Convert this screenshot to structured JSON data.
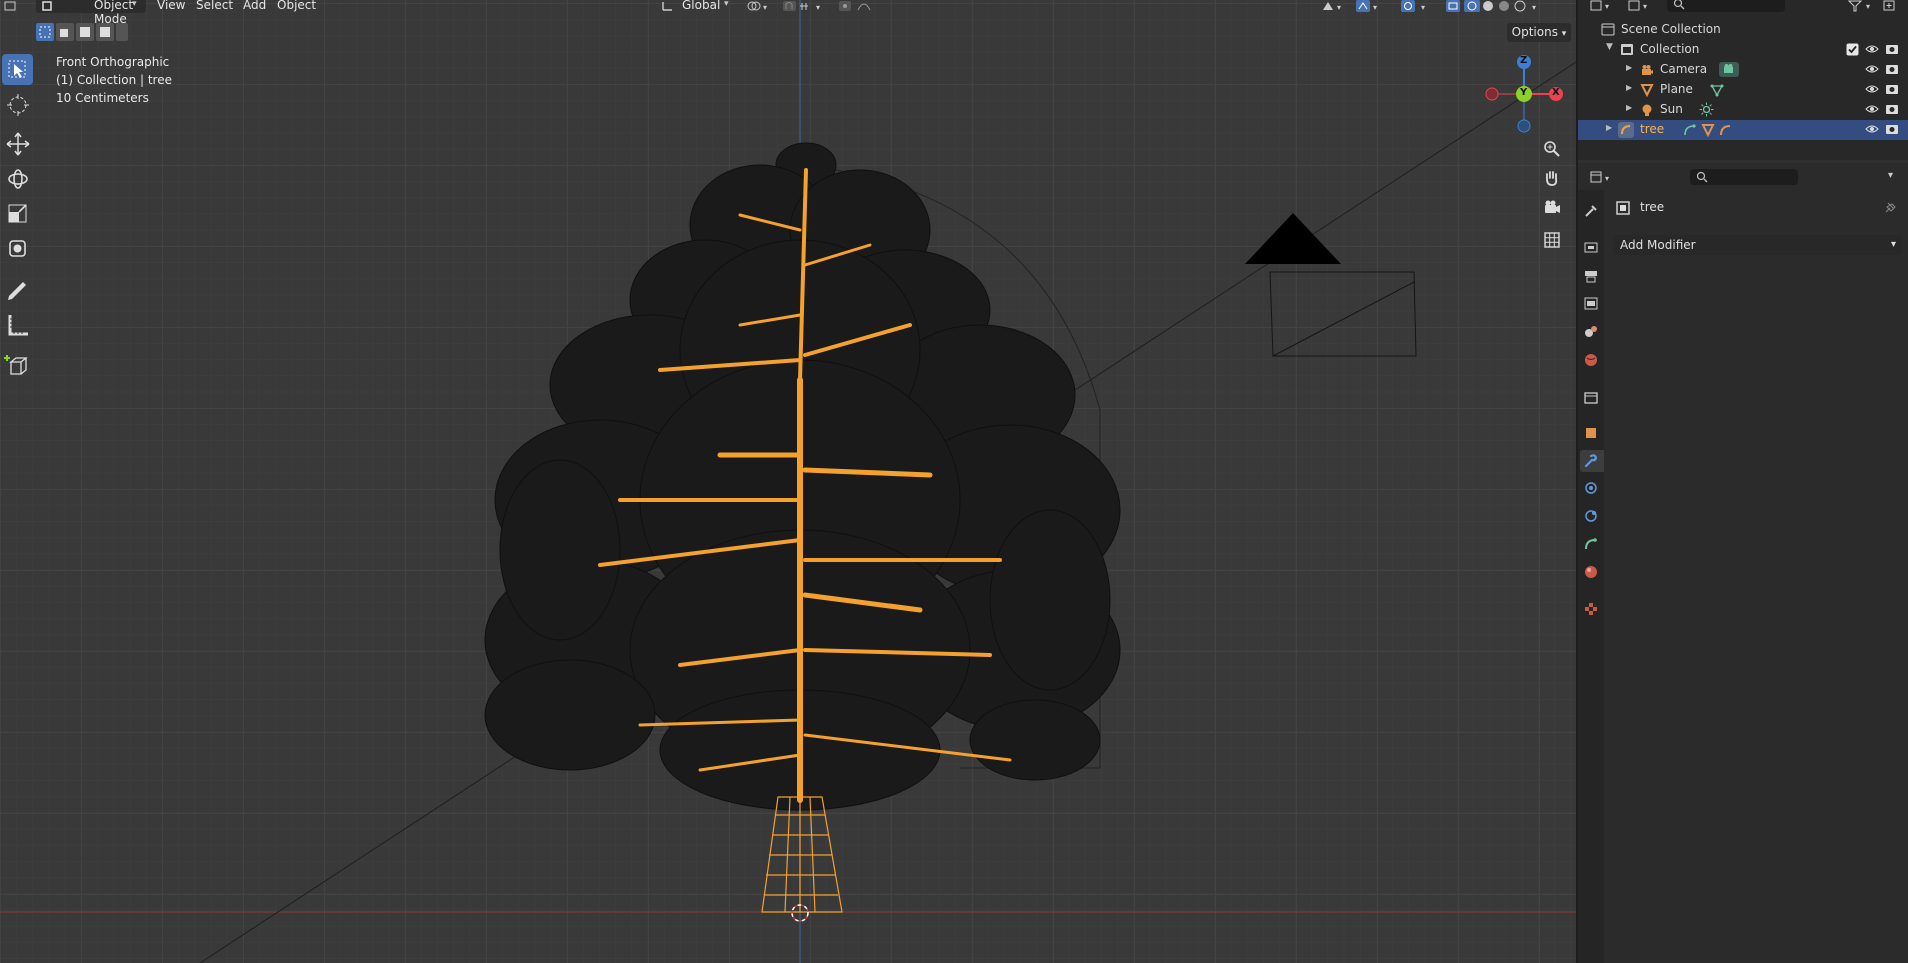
{
  "header": {
    "mode_label": "Object Mode",
    "menus": [
      "View",
      "Select",
      "Add",
      "Object"
    ],
    "orientation_label": "Global",
    "options_label": "Options"
  },
  "viewport": {
    "view_name": "Front Orthographic",
    "collection_info": "(1) Collection | tree",
    "scale_info": "10 Centimeters",
    "gizmo": {
      "z_label": "Z",
      "y_label": "Y",
      "x_label": "X"
    }
  },
  "outliner": {
    "scene_collection": "Scene Collection",
    "collection": "Collection",
    "items": [
      {
        "label": "Camera"
      },
      {
        "label": "Plane"
      },
      {
        "label": "Sun"
      },
      {
        "label": "tree"
      }
    ]
  },
  "properties": {
    "object_name": "tree",
    "add_modifier_label": "Add Modifier"
  },
  "colors": {
    "selected_orange": "#f5a12e",
    "active_blue": "#4772b3",
    "gizmo_x": "#e8434e",
    "gizmo_y": "#8bd12a",
    "gizmo_z": "#3c7fd6"
  }
}
